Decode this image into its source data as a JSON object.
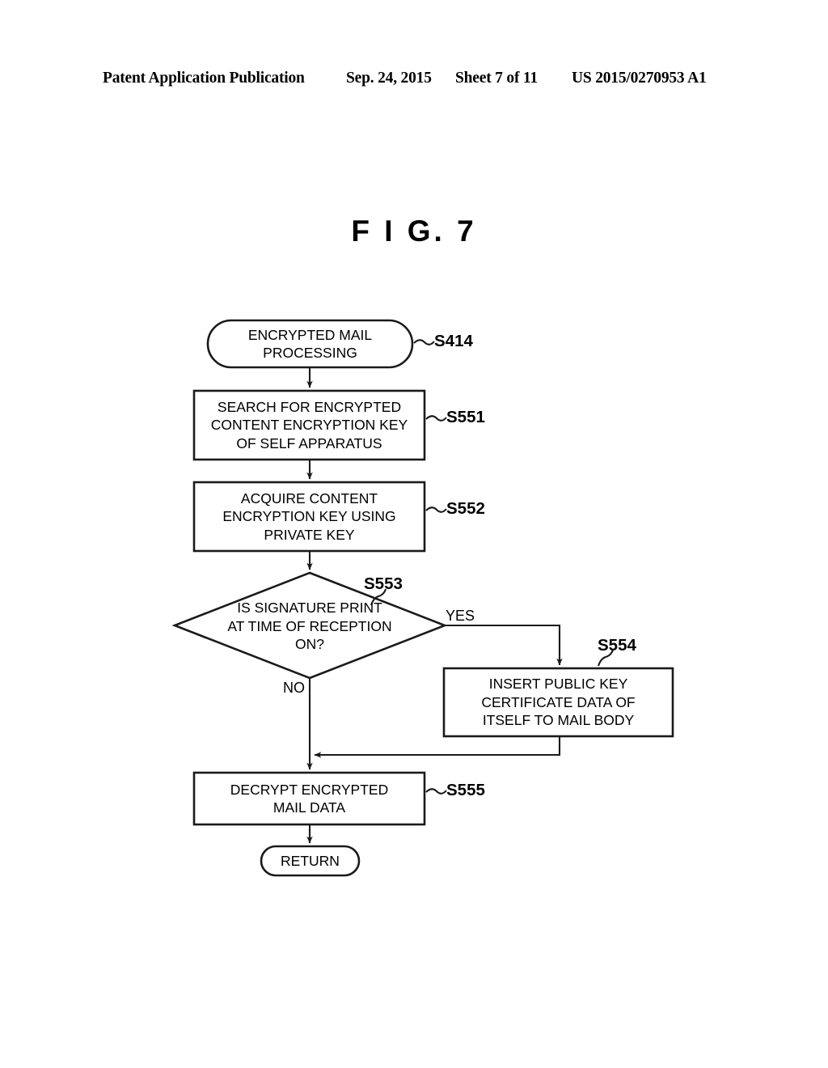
{
  "header": {
    "publication": "Patent Application Publication",
    "date": "Sep. 24, 2015",
    "sheet": "Sheet 7 of 11",
    "number": "US 2015/0270953 A1"
  },
  "figure": {
    "title": "F I G.  7"
  },
  "flowchart": {
    "nodes": [
      {
        "id": "start",
        "shape": "terminator",
        "lines": [
          "ENCRYPTED MAIL",
          "PROCESSING"
        ],
        "step": "S414"
      },
      {
        "id": "s551",
        "shape": "process",
        "lines": [
          "SEARCH FOR ENCRYPTED",
          "CONTENT ENCRYPTION KEY",
          "OF SELF APPARATUS"
        ],
        "step": "S551"
      },
      {
        "id": "s552",
        "shape": "process",
        "lines": [
          "ACQUIRE CONTENT",
          "ENCRYPTION KEY USING",
          "PRIVATE KEY"
        ],
        "step": "S552"
      },
      {
        "id": "s553",
        "shape": "decision",
        "lines": [
          "IS SIGNATURE PRINT",
          "AT TIME OF RECEPTION",
          "ON?"
        ],
        "step": "S553"
      },
      {
        "id": "s554",
        "shape": "process",
        "lines": [
          "INSERT PUBLIC KEY",
          "CERTIFICATE DATA OF",
          "ITSELF TO MAIL BODY"
        ],
        "step": "S554"
      },
      {
        "id": "s555",
        "shape": "process",
        "lines": [
          "DECRYPT ENCRYPTED",
          "MAIL DATA"
        ],
        "step": "S555"
      },
      {
        "id": "return",
        "shape": "terminator",
        "lines": [
          "RETURN"
        ],
        "step": ""
      }
    ],
    "branches": {
      "yes": "YES",
      "no": "NO"
    }
  },
  "colors": {
    "ink": "#1a1a1a",
    "paper": "#ffffff"
  }
}
